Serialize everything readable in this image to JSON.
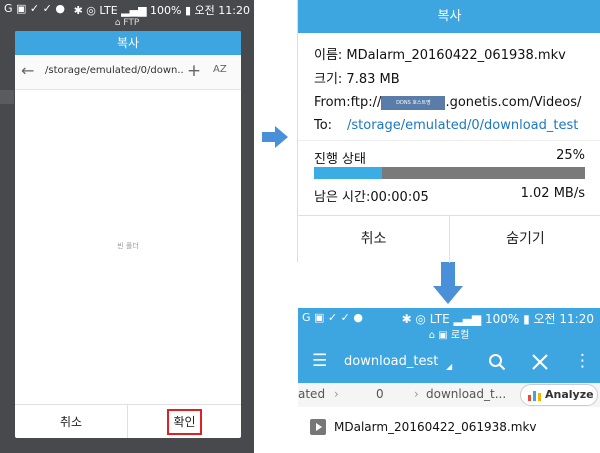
{
  "left": {
    "status_left": "G ▣ ✓ ✓ ●",
    "status_right": "✱ ◎ LTE ▂▄▆ 100% ▮ 오전 11:20",
    "ftp_strip": "⌂ FTP",
    "dialog": {
      "title": "복사",
      "path": "/storage/emulated/0/down...",
      "back_glyph": "←",
      "plus_glyph": "+",
      "sort_glyph": "AZ",
      "empty_text": "빈 폴더",
      "cancel": "취소",
      "ok": "확인"
    }
  },
  "progress": {
    "title": "복사",
    "name_line": "이름: MDalarm_20160422_061938.mkv",
    "size_line": "크기: 7.83 MB",
    "from_prefix": "From:ftp://",
    "from_masked": "DDNS 호스트명",
    "from_suffix": ".gonetis.com/Videos/",
    "to_label": "To:",
    "to_path": "/storage/emulated/0/download_test",
    "state_label": "진행 상태",
    "percent_label": "25%",
    "progress_value": 0.25,
    "remaining": "남은 시간:00:00:05",
    "speed": "1.02 MB/s",
    "cancel": "취소",
    "hide": "숨기기"
  },
  "app": {
    "status_left": "G ▣ ✓ ✓ ●",
    "status_right": "✱ ◎ LTE ▂▄▆ 100% ▮ 오전 11:20",
    "sub_title": "⌂ ▣ 로컬",
    "folder": "download_test",
    "crumbs": [
      "ated",
      "0",
      "download_t..."
    ],
    "crumb_sep": "›",
    "analyze": "Analyze",
    "file_name": "MDalarm_20160422_061938.mkv"
  },
  "colors": {
    "accent": "#3da6e0",
    "progress_fill": "#3aaee4",
    "progress_track": "#7a7a7a",
    "link": "#1a78c2",
    "highlight": "#e32020"
  }
}
